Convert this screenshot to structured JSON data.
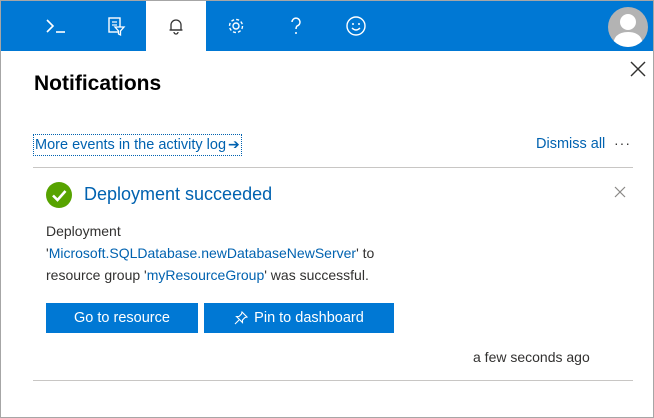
{
  "topbar": {
    "items": [
      {
        "name": "cloud-shell",
        "icon": "terminal-icon"
      },
      {
        "name": "directory-filter",
        "icon": "filter-icon"
      },
      {
        "name": "notifications",
        "icon": "bell-icon",
        "active": true
      },
      {
        "name": "settings",
        "icon": "gear-icon"
      },
      {
        "name": "help",
        "icon": "question-icon"
      },
      {
        "name": "feedback",
        "icon": "smiley-icon"
      }
    ],
    "accent_color": "#0078d4"
  },
  "panel": {
    "title": "Notifications",
    "activity_link_label": "More events in the activity log",
    "activity_link_arrow": "➔",
    "dismiss_all_label": "Dismiss all",
    "more_label": "···"
  },
  "notification": {
    "status_icon": "success-check-icon",
    "status_color": "#57a300",
    "title": "Deployment succeeded",
    "body_line1": "Deployment",
    "body_quote_open": "'",
    "deployment_name": "Microsoft.SQLDatabase.newDatabaseNewServer",
    "body_mid": "' to",
    "body_line3_prefix": "resource group '",
    "resource_group": "myResourceGroup",
    "body_line3_suffix": "' was successful.",
    "go_to_resource_label": "Go to resource",
    "pin_to_dashboard_label": "Pin to dashboard",
    "timestamp": "a few seconds ago"
  }
}
